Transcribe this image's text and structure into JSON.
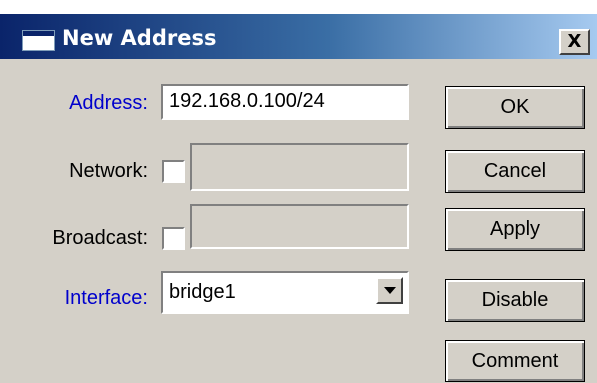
{
  "window": {
    "title": "New Address",
    "close_label": "X"
  },
  "form": {
    "address": {
      "label": "Address:",
      "value": "192.168.0.100/24"
    },
    "network": {
      "label": "Network:",
      "checked": false,
      "value": ""
    },
    "broadcast": {
      "label": "Broadcast:",
      "checked": false,
      "value": ""
    },
    "interface": {
      "label": "Interface:",
      "value": "bridge1"
    }
  },
  "buttons": {
    "ok": "OK",
    "cancel": "Cancel",
    "apply": "Apply",
    "disable": "Disable",
    "comment": "Comment"
  },
  "colors": {
    "required_label": "#0000cc",
    "title_bar": "#0a246a",
    "dialog_background": "#d4d0c8"
  }
}
